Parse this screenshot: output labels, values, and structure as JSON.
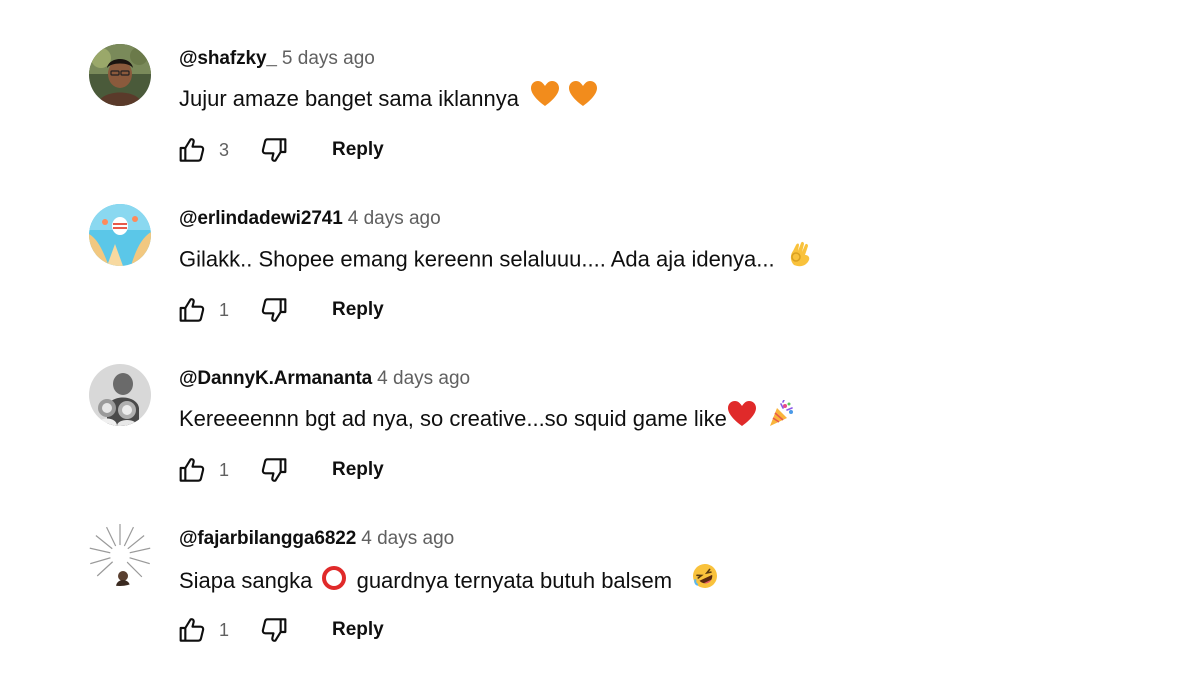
{
  "comments": [
    {
      "author": "@shafzky_",
      "timestamp": "5 days ago",
      "text": "Jujur amaze banget sama iklannya",
      "emojis": [
        "orange-heart",
        "orange-heart"
      ],
      "likes": "3",
      "reply_label": "Reply"
    },
    {
      "author": "@erlindadewi2741",
      "timestamp": "4 days ago",
      "text": "Gilakk.. Shopee emang kereenn selaluuu.... Ada aja idenya...",
      "emojis": [
        "ok-hand"
      ],
      "likes": "1",
      "reply_label": "Reply"
    },
    {
      "author": "@DannyK.Armananta",
      "timestamp": "4 days ago",
      "text": "Kereeeennn bgt ad nya, so creative...so squid game like",
      "emojis": [
        "red-heart",
        "party-popper"
      ],
      "likes": "1",
      "reply_label": "Reply"
    },
    {
      "author": "@fajarbilangga6822",
      "timestamp": "4 days ago",
      "text_before": "Siapa sangka",
      "text_after": "guardnya ternyata butuh balsem",
      "emojis": [
        "red-circle",
        "rolling-laughing"
      ],
      "likes": "1",
      "reply_label": "Reply"
    }
  ],
  "colors": {
    "text": "#0f0f0f",
    "secondary": "#606060",
    "background": "#ffffff"
  }
}
